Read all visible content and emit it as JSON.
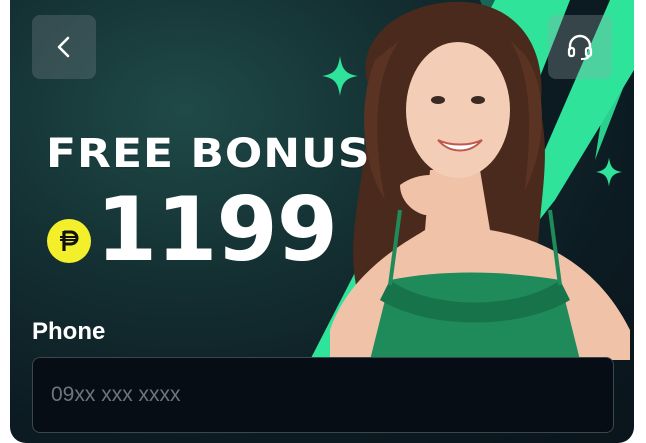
{
  "header": {
    "back_icon": "chevron-left-icon",
    "support_icon": "headset-icon"
  },
  "promo": {
    "title": "FREE BONUS",
    "currency_icon": "peso-icon",
    "amount": "1199"
  },
  "form": {
    "phone_label": "Phone",
    "phone_placeholder": "09xx xxx xxxx",
    "phone_value": ""
  },
  "colors": {
    "accent_green": "#2fe39a",
    "badge_yellow": "#f3ef2a",
    "background_dark": "#0c1b22"
  }
}
